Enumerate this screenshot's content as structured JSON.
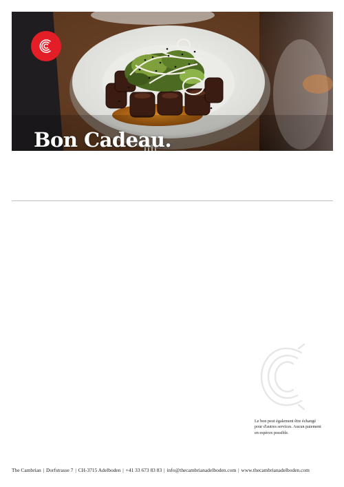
{
  "hero": {
    "title": "Bon Cadeau.",
    "image_subject": "plated-dish-photo"
  },
  "brand": {
    "accent": "#e41e26",
    "logo_icon": "cambrian-c-logo-icon"
  },
  "note": {
    "lines": [
      "Le bon peut également être échangé",
      "pour d'autres services. Aucun paiement",
      "en espèces possible."
    ]
  },
  "footer": {
    "name": "The Cambrian",
    "street": "Dorfstrasse 7",
    "city": "CH-3715 Adelboden",
    "phone": "+41 33 673 83 83",
    "email": "info@thecambrianadelboden.com",
    "website": "www.thecambrianadelboden.com"
  }
}
